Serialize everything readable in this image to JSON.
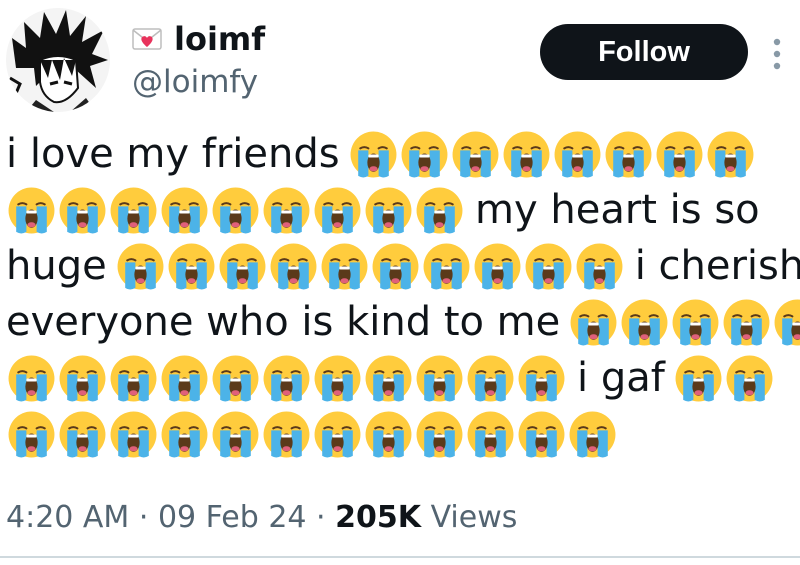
{
  "author": {
    "display_name": "loimf",
    "handle": "@loimfy",
    "name_icon": "love-letter-emoji-icon",
    "avatar": "manga-character-avatar"
  },
  "follow_button": {
    "label": "Follow"
  },
  "more_menu": {
    "icon": "more-vertical-icon"
  },
  "emoji_icon": "loudly-crying-face-emoji",
  "body": {
    "lines": [
      [
        {
          "t": "text",
          "v": "i love my friends"
        },
        {
          "t": "emoji",
          "n": 8
        }
      ],
      [
        {
          "t": "emoji",
          "n": 9
        },
        {
          "t": "text",
          "v": "my heart is so"
        }
      ],
      [
        {
          "t": "text",
          "v": "huge"
        },
        {
          "t": "emoji",
          "n": 10
        },
        {
          "t": "text",
          "v": "i cherish"
        }
      ],
      [
        {
          "t": "text",
          "v": "everyone who is kind to me"
        },
        {
          "t": "emoji",
          "n": 5
        }
      ],
      [
        {
          "t": "emoji",
          "n": 11
        },
        {
          "t": "text",
          "v": "i gaf"
        },
        {
          "t": "emoji",
          "n": 2
        }
      ],
      [
        {
          "t": "emoji",
          "n": 12
        }
      ]
    ]
  },
  "meta": {
    "time": "4:20 AM",
    "separator": "·",
    "date": "09 Feb 24",
    "views_count": "205K",
    "views_label": "Views"
  },
  "colors": {
    "follow_bg": "#0f1419",
    "secondary_text": "#536471",
    "emoji_face": "#ffcc3d",
    "emoji_tears": "#4cb3e8"
  }
}
